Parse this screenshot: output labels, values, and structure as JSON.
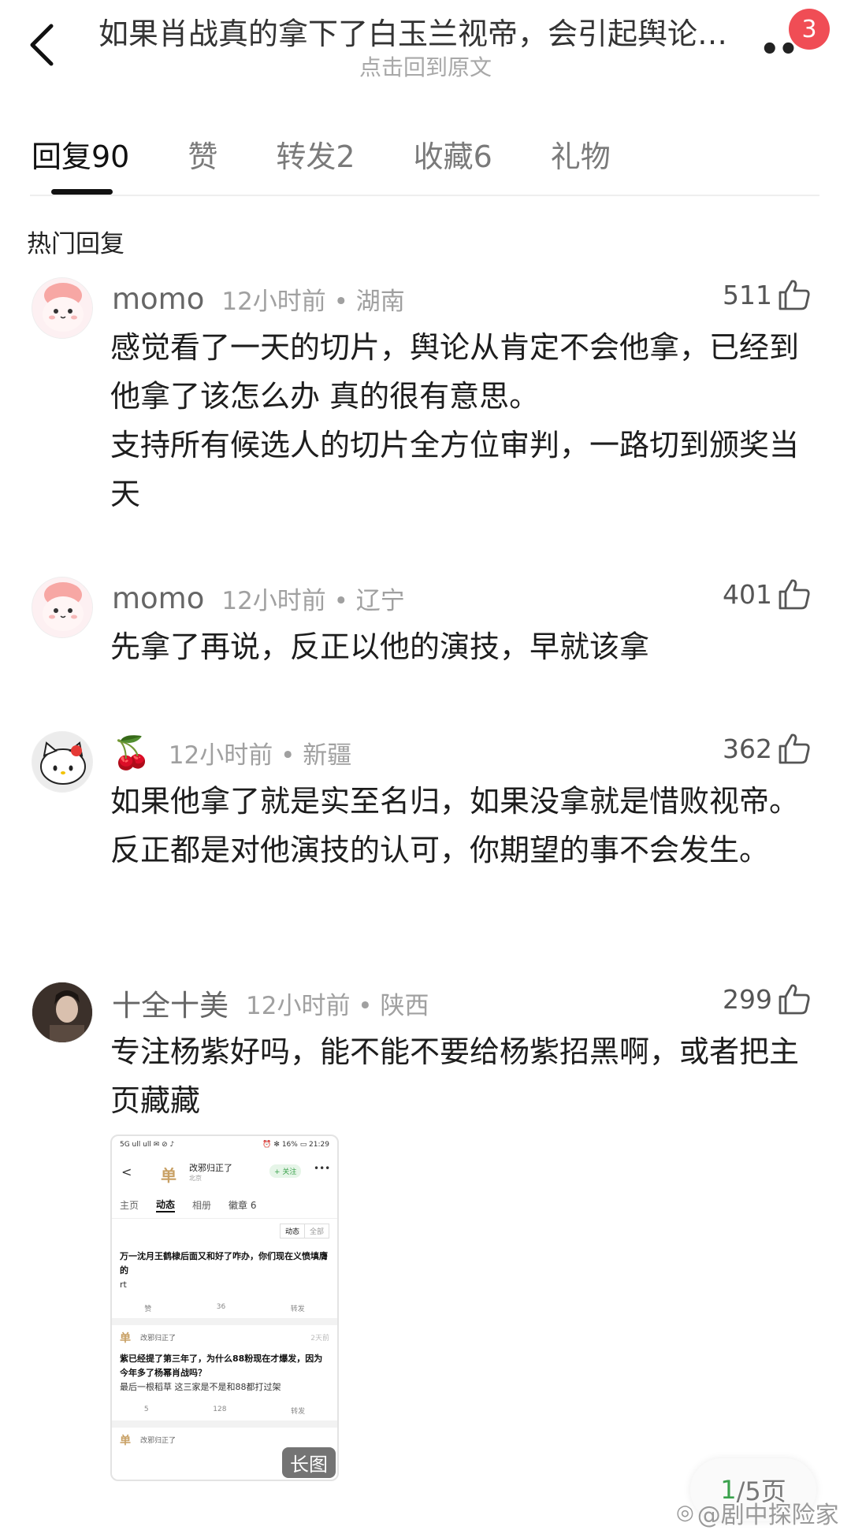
{
  "header": {
    "title": "如果肖战真的拿下了白玉兰视帝，会引起舆论…",
    "subtitle": "点击回到原文",
    "more_label": "••",
    "badge_count": "3"
  },
  "tabs": [
    {
      "label": "回复90",
      "active": true
    },
    {
      "label": "赞",
      "active": false
    },
    {
      "label": "转发2",
      "active": false
    },
    {
      "label": "收藏6",
      "active": false
    },
    {
      "label": "礼物",
      "active": false
    }
  ],
  "section_label": "热门回复",
  "comments": [
    {
      "user": "momo",
      "meta": "12小时前 • 湖南",
      "likes": "511",
      "lines": [
        "感觉看了一天的切片，舆论从肯定不会他拿，已经到他拿了该怎么办 真的很有意思。",
        "支持所有候选人的切片全方位审判，一路切到颁奖当天"
      ]
    },
    {
      "user": "momo",
      "meta": "12小时前 • 辽宁",
      "likes": "401",
      "lines": [
        "先拿了再说，反正以他的演技，早就该拿"
      ]
    },
    {
      "user": "🍒",
      "meta": "12小时前 • 新疆",
      "likes": "362",
      "lines": [
        "如果他拿了就是实至名归，如果没拿就是惜败视帝。反正都是对他演技的认可，你期望的事不会发生。"
      ]
    },
    {
      "user": "十全十美",
      "meta": "12小时前 • 陕西",
      "likes": "299",
      "lines": [
        "专注杨紫好吗，能不能不要给杨紫招黑啊，或者把主页藏藏"
      ]
    }
  ],
  "embedded_image": {
    "status_left": "5G ull ull ✉ ⊘ ♪",
    "status_right": "⏰ ✻ 16% ▭ 21:29",
    "back": "<",
    "avatar_char": "单",
    "username": "改邪归正了",
    "location": "北京",
    "follow": "+ 关注",
    "more": "•••",
    "tabs": [
      "主页",
      "动态",
      "相册",
      "徽章 6"
    ],
    "filter": [
      "动态",
      "全部"
    ],
    "post1_title": "万一沈月王鹤棣后面又和好了咋办，你们现在义愤填膺的",
    "post1_body": "rt",
    "post1_actions": [
      "赞",
      "36",
      "转发"
    ],
    "post2_user": "改邪归正了",
    "post2_time": "2天前",
    "post2_title": "紫已经提了第三年了，为什么88粉现在才爆发，因为今年多了杨幂肖战吗？",
    "post2_body": "最后一根稻草 这三家是不是和88都打过架",
    "post2_actions": [
      "5",
      "128",
      "转发"
    ],
    "post3_user": "改邪归正了",
    "long_tag": "长图"
  },
  "page_indicator": {
    "current": "1",
    "rest": "/5页"
  },
  "watermark": "@剧中探险家"
}
